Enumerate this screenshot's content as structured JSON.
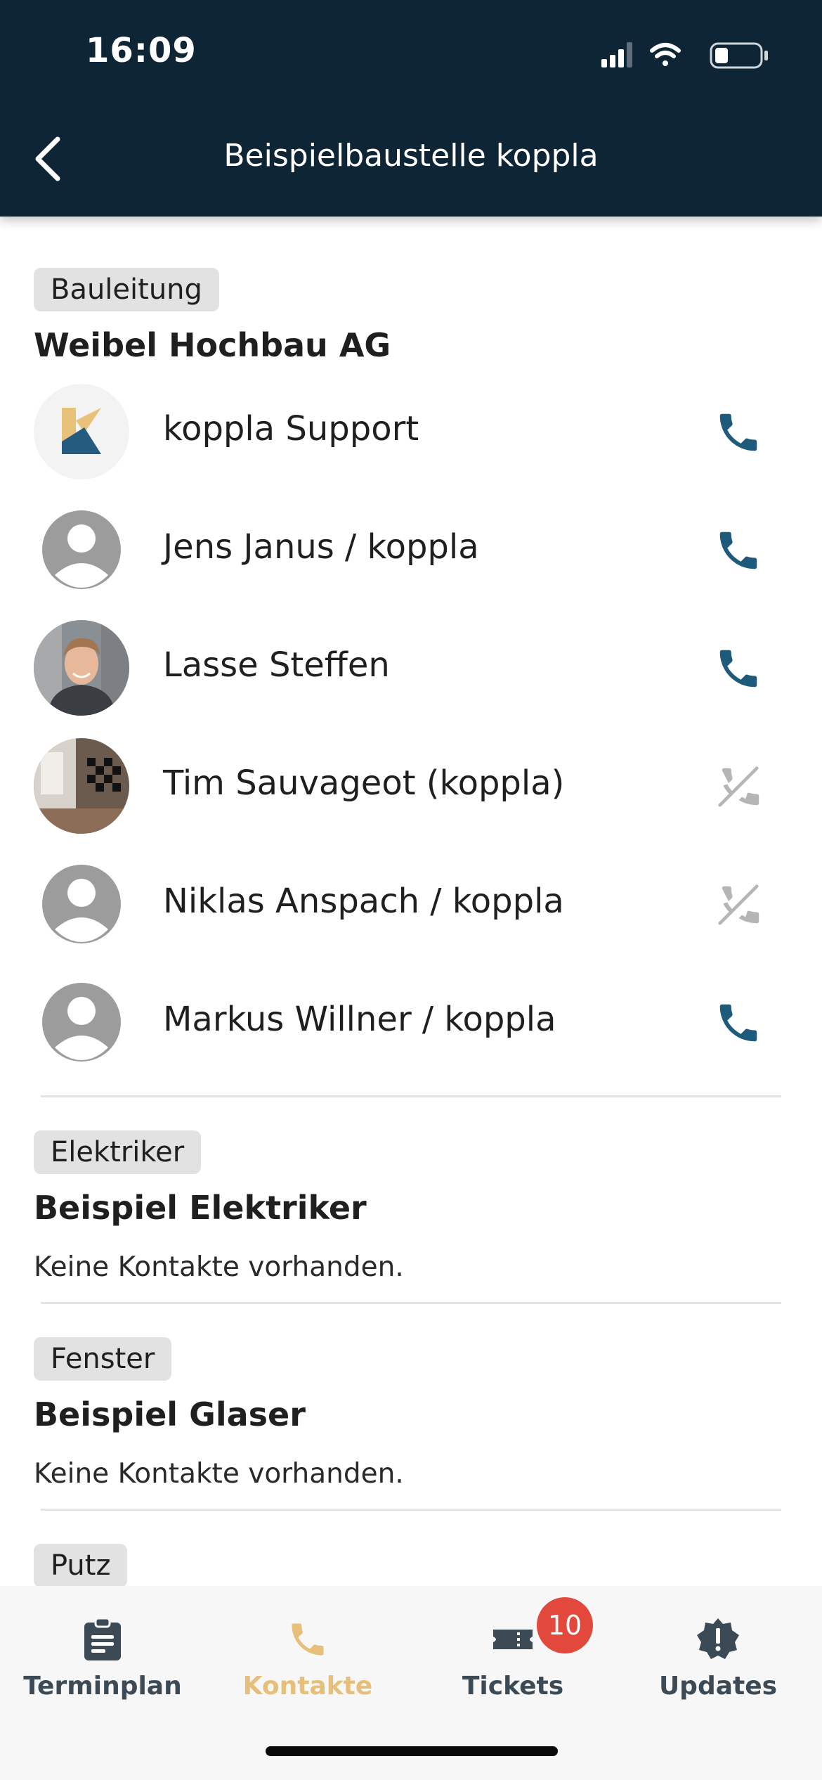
{
  "status_bar": {
    "time": "16:09"
  },
  "header": {
    "title": "Beispielbaustelle koppla"
  },
  "groups": [
    {
      "role": "Bauleitung",
      "company": "Weibel Hochbau AG",
      "contacts": [
        {
          "name": "koppla Support",
          "avatar": "koppla-logo",
          "phone_available": true
        },
        {
          "name": "Jens Janus / koppla",
          "avatar": "person-placeholder",
          "phone_available": true
        },
        {
          "name": "Lasse Steffen",
          "avatar": "photo",
          "phone_available": true
        },
        {
          "name": "Tim Sauvageot (koppla)",
          "avatar": "photo",
          "phone_available": false
        },
        {
          "name": "Niklas Anspach / koppla",
          "avatar": "person-placeholder",
          "phone_available": false
        },
        {
          "name": "Markus Willner / koppla",
          "avatar": "person-placeholder",
          "phone_available": true
        }
      ]
    },
    {
      "role": "Elektriker",
      "company": "Beispiel Elektriker",
      "empty_text": "Keine Kontakte vorhanden."
    },
    {
      "role": "Fenster",
      "company": "Beispiel Glaser",
      "empty_text": "Keine Kontakte vorhanden."
    },
    {
      "role": "Putz"
    }
  ],
  "bottom_nav": {
    "items": [
      {
        "label": "Terminplan",
        "icon": "clipboard-icon",
        "active": false
      },
      {
        "label": "Kontakte",
        "icon": "phone-icon",
        "active": true
      },
      {
        "label": "Tickets",
        "icon": "ticket-icon",
        "active": false,
        "badge": "10"
      },
      {
        "label": "Updates",
        "icon": "alert-badge-icon",
        "active": false
      }
    ]
  },
  "colors": {
    "header_bg": "#0e2535",
    "phone_active": "#1d5a7c",
    "phone_disabled": "#b5b5b5",
    "nav_active": "#e6c07a",
    "nav_inactive": "#3c4a56",
    "badge": "#e2483c",
    "chip_bg": "#e2e2e2"
  }
}
